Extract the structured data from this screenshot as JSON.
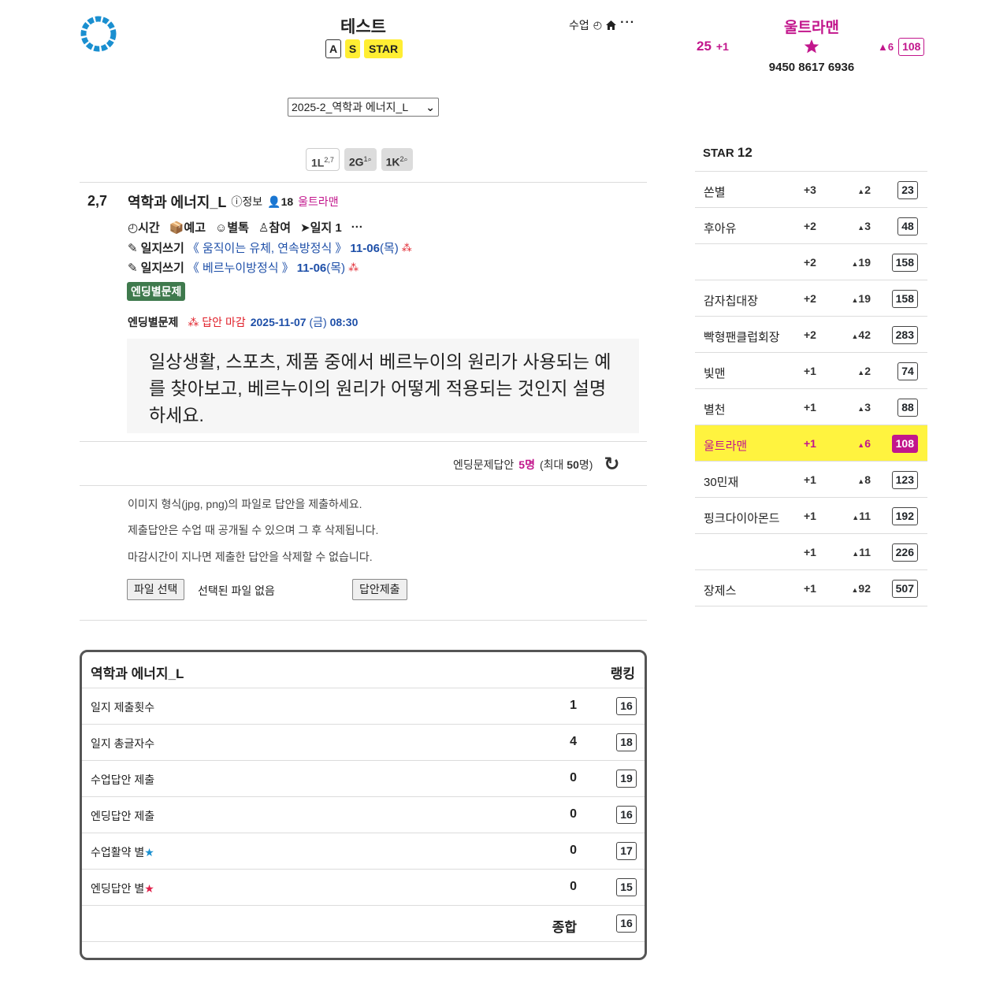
{
  "header": {
    "title": "테스트",
    "badges": [
      "A",
      "S",
      "STAR"
    ],
    "actions": {
      "class_label": "수업",
      "clock_icon": "clock-icon",
      "home_icon": "home-icon",
      "more": "···"
    }
  },
  "user": {
    "name": "울트라맨",
    "score": "25",
    "score_plus": "+1",
    "rank_change": "6",
    "rank": "108",
    "phone": "9450 8617 6936"
  },
  "course_select": {
    "value": "2025-2_역학과 에너지_L",
    "arrow": "⌄"
  },
  "levels": [
    {
      "label": "1L",
      "sup": "2,7"
    },
    {
      "label": "2G",
      "sup": "1"
    },
    {
      "label": "1K",
      "sup": "2"
    }
  ],
  "lesson": {
    "number": "2,7",
    "title": "역학과 에너지_L",
    "info_label": "정보",
    "participants": "18",
    "teacher": "울트라맨",
    "actions": {
      "time": "시간",
      "preview": "예고",
      "separate": "별톡",
      "join": "참여",
      "journal": "일지",
      "journal_count": "1",
      "more": "···"
    },
    "journals": [
      {
        "label": "일지쓰기",
        "link": "《 움직이는 유체, 연속방정식 》",
        "date": "11-06",
        "day": "(목)"
      },
      {
        "label": "일지쓰기",
        "link": "《 베르누이방정식 》",
        "date": "11-06",
        "day": "(목)"
      }
    ],
    "tag": "엔딩별문제",
    "deadline": {
      "label": "엔딩별문제",
      "status": "답안 마감",
      "date": "2025-11-07",
      "day": "(금)",
      "time": "08:30"
    },
    "question": "일상생활, 스포츠, 제품 중에서 베르누이의 원리가 사용되는 예를 찾아보고, 베르누이의 원리가 어떻게 적용되는 것인지 설명하세요.",
    "answer_count": {
      "label": "엔딩문제답안",
      "count": "5명",
      "open": "(최대",
      "max": "50",
      "close": "명)"
    },
    "notices": [
      "이미지 형식(jpg, png)의 파일로 답안을 제출하세요.",
      "제출답안은 수업 때 공개될 수 있으며 그 후 삭제됩니다.",
      "마감시간이 지나면 제출한 답안을 삭제할 수 없습니다."
    ],
    "file_button": "파일 선택",
    "file_status": "선택된 파일 없음",
    "submit_button": "답안제출"
  },
  "stats": {
    "title": "역학과 에너지_L",
    "rank_header": "랭킹",
    "rows": [
      {
        "label": "일지 제출횟수",
        "value": "1",
        "rank": "16"
      },
      {
        "label": "일지 총글자수",
        "value": "4",
        "rank": "18"
      },
      {
        "label": "수업답안 제출",
        "value": "0",
        "rank": "19"
      },
      {
        "label": "엔딩답안 제출",
        "value": "0",
        "rank": "16"
      },
      {
        "label": "수업활약 별",
        "value": "0",
        "rank": "17",
        "star_color": "#1a8fd0"
      },
      {
        "label": "엔딩답안 별",
        "value": "0",
        "rank": "15",
        "star_color": "#e0204a"
      }
    ],
    "total_label": "종합",
    "total_rank": "16"
  },
  "leaderboard": {
    "title": "STAR",
    "count": "12",
    "rows": [
      {
        "name": "쏜별",
        "plus": "+3",
        "change": "2",
        "rank": "23"
      },
      {
        "name": "후아유",
        "plus": "+2",
        "change": "3",
        "rank": "48"
      },
      {
        "name": "",
        "plus": "+2",
        "change": "19",
        "rank": "158"
      },
      {
        "name": "감자칩대장",
        "plus": "+2",
        "change": "19",
        "rank": "158"
      },
      {
        "name": "빡형팬클럽회장",
        "plus": "+2",
        "change": "42",
        "rank": "283"
      },
      {
        "name": "빛맨",
        "plus": "+1",
        "change": "2",
        "rank": "74"
      },
      {
        "name": "별천",
        "plus": "+1",
        "change": "3",
        "rank": "88"
      },
      {
        "name": "울트라맨",
        "plus": "+1",
        "change": "6",
        "rank": "108",
        "highlight": true
      },
      {
        "name": "30민재",
        "plus": "+1",
        "change": "8",
        "rank": "123"
      },
      {
        "name": "핑크다이아몬드",
        "plus": "+1",
        "change": "11",
        "rank": "192"
      },
      {
        "name": "",
        "plus": "+1",
        "change": "11",
        "rank": "226"
      },
      {
        "name": "장제스",
        "plus": "+1",
        "change": "92",
        "rank": "507"
      }
    ]
  },
  "colors": {
    "accent": "#c2168c",
    "highlight": "#fff33f",
    "link": "#1e4fa8",
    "tag": "#3f7a4d",
    "logo": "#1a8fd0"
  }
}
